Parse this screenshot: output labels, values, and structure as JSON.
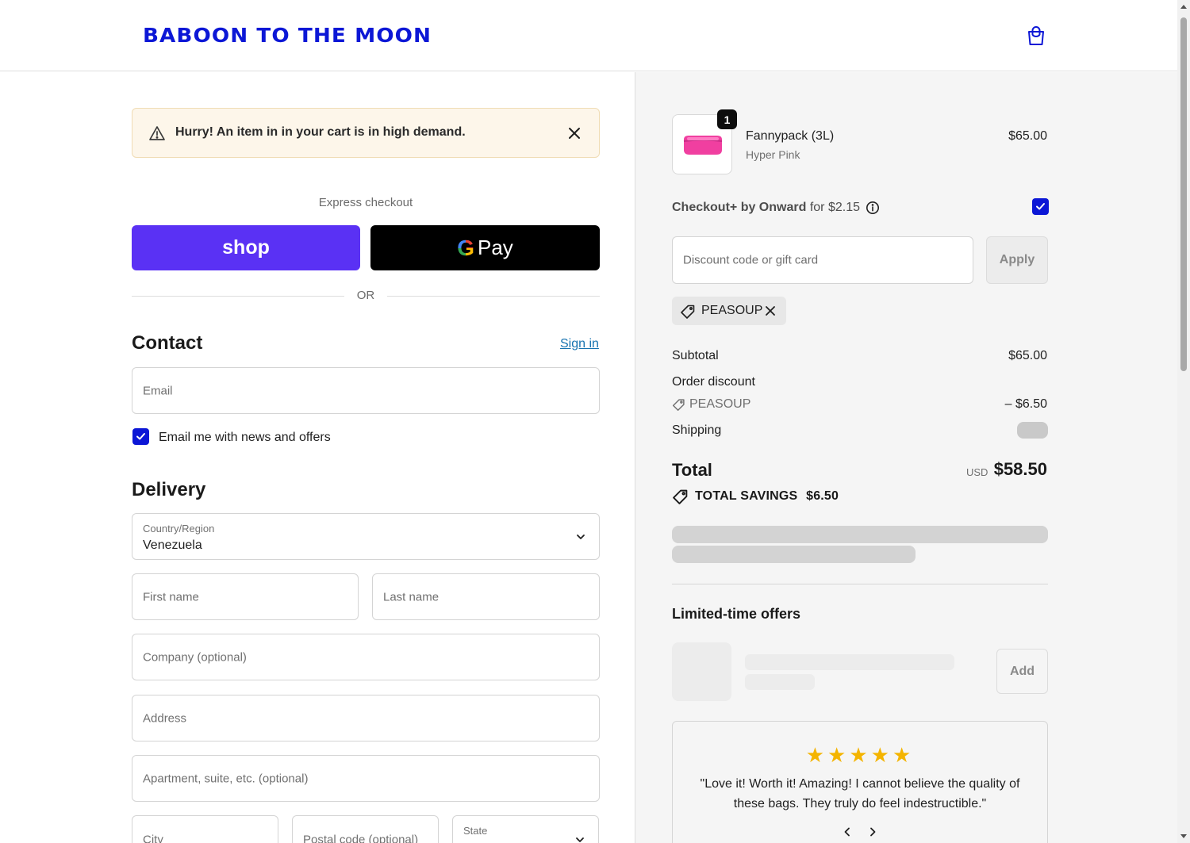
{
  "header": {
    "logo_text": "BABOON TO THE MOON",
    "cart_icon": "shopping-bag-icon"
  },
  "alert": {
    "text": "Hurry! An item in in your cart is in high demand.",
    "icon": "warning-icon",
    "close_icon": "close-icon"
  },
  "express": {
    "label": "Express checkout",
    "shop_label": "shop",
    "gpay_g": "G",
    "gpay_label": "Pay",
    "or_label": "OR"
  },
  "contact": {
    "title": "Contact",
    "sign_in": "Sign in",
    "email_placeholder": "Email",
    "newsletter_label": "Email me with news and offers",
    "newsletter_checked": true
  },
  "delivery": {
    "title": "Delivery",
    "country_label": "Country/Region",
    "country_value": "Venezuela",
    "first_name_placeholder": "First name",
    "last_name_placeholder": "Last name",
    "company_placeholder": "Company (optional)",
    "address_placeholder": "Address",
    "apartment_placeholder": "Apartment, suite, etc. (optional)",
    "city_placeholder": "City",
    "postal_placeholder": "Postal code (optional)",
    "state_label": "State"
  },
  "cart": {
    "item": {
      "name": "Fannypack (3L)",
      "variant": "Hyper Pink",
      "price": "$65.00",
      "quantity": "1"
    },
    "checkout_plus": {
      "brand": "Checkout+ by Onward",
      "suffix": "for $2.15",
      "checked": true
    },
    "discount_placeholder": "Discount code or gift card",
    "apply_label": "Apply",
    "applied_code": "PEASOUP",
    "summary": {
      "subtotal_label": "Subtotal",
      "subtotal_value": "$65.00",
      "order_discount_label": "Order discount",
      "discount_code": "PEASOUP",
      "discount_value": "– $6.50",
      "shipping_label": "Shipping"
    },
    "total": {
      "label": "Total",
      "currency": "USD",
      "value": "$58.50",
      "savings_label": "TOTAL SAVINGS",
      "savings_value": "$6.50"
    }
  },
  "offers": {
    "title": "Limited-time offers",
    "add_label": "Add"
  },
  "review": {
    "stars": "★★★★★",
    "rating": 5,
    "text": "\"Love it! Worth it! Amazing! I cannot believe the quality of these bags. They truly do feel indestructible.\""
  },
  "colors": {
    "brand": "#0c17d6",
    "shop_pay": "#5a31f4",
    "star": "#f4b400",
    "link": "#1773b0"
  }
}
